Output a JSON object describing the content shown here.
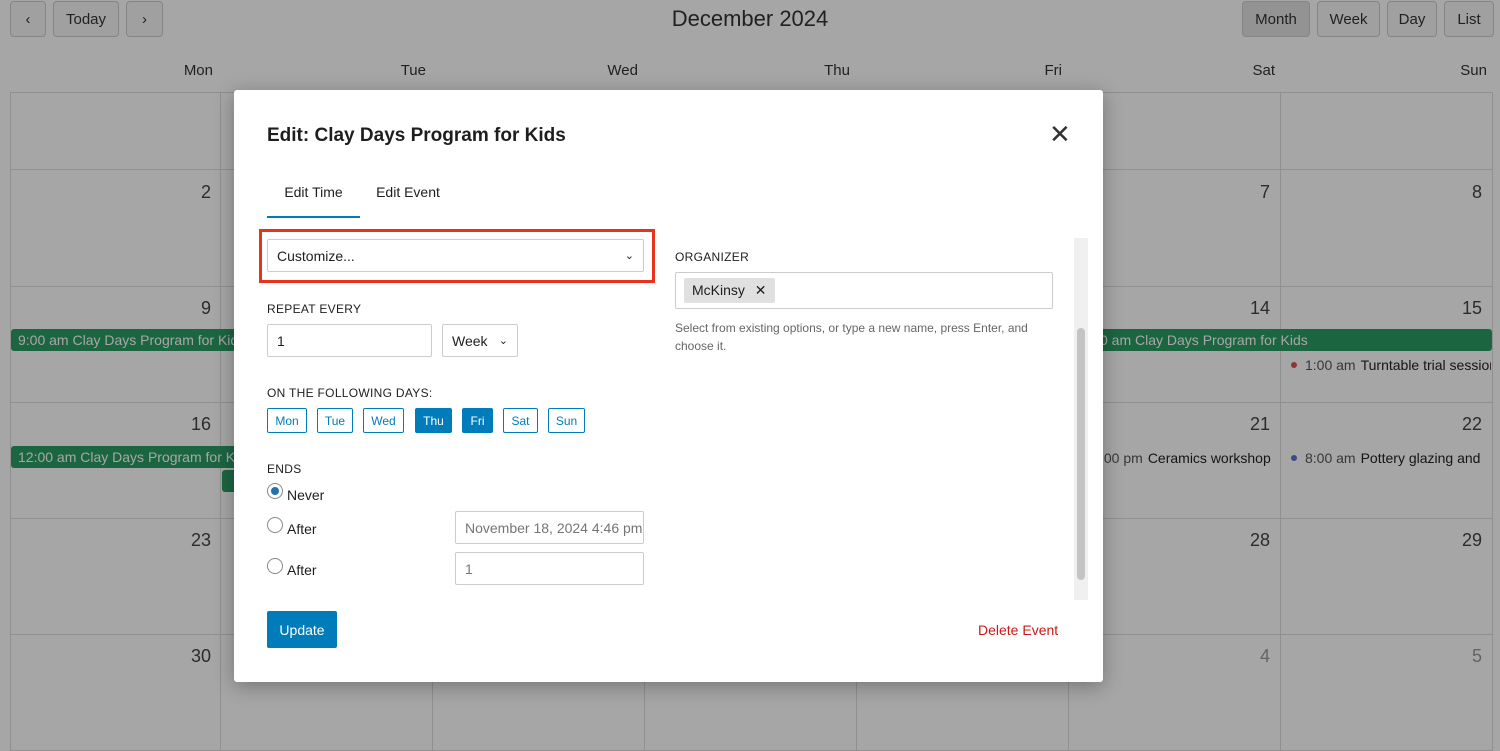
{
  "toolbar": {
    "prev_icon": "chevron-left-icon",
    "today": "Today",
    "next_icon": "chevron-right-icon",
    "title": "December 2024",
    "views": [
      "Month",
      "Week",
      "Day",
      "List"
    ],
    "active_view": "Month"
  },
  "weekdays": [
    "Mon",
    "Tue",
    "Wed",
    "Thu",
    "Fri",
    "Sat",
    "Sun"
  ],
  "dates": {
    "r2": {
      "mon": "2",
      "sat": "7",
      "sun": "8"
    },
    "r3": {
      "mon": "9",
      "sat": "14",
      "sun": "15"
    },
    "r4": {
      "mon": "16",
      "sat": "21",
      "sun": "22"
    },
    "r5": {
      "mon": "23",
      "sat": "28",
      "sun": "29"
    },
    "r6": {
      "mon": "30",
      "sat": "4",
      "sun": "5"
    }
  },
  "events": {
    "e1": {
      "time": "9:00 am",
      "title": "Clay Days Program for Kids"
    },
    "e2": {
      "time": "0 am",
      "title": "Clay Days Program for Kids"
    },
    "e3": {
      "time": "1:00 am",
      "title": "Turntable trial session",
      "color": "#d9534f"
    },
    "e4": {
      "time": "12:00 am",
      "title": "Clay Days Program for Kids"
    },
    "e5": {
      "time": ":00 pm",
      "title": "Ceramics workshop"
    },
    "e6": {
      "time": "8:00 am",
      "title": "Pottery glazing and",
      "color": "#5b6fd6"
    },
    "event_color": "#2a9d64"
  },
  "modal": {
    "title": "Edit: Clay Days Program for Kids",
    "close_icon": "close-icon",
    "tabs": [
      "Edit Time",
      "Edit Event"
    ],
    "active_tab": "Edit Time",
    "recurrence": "Customize...",
    "repeat_every_label": "REPEAT EVERY",
    "repeat_every_value": "1",
    "repeat_unit": "Week",
    "days_label": "ON THE FOLLOWING DAYS:",
    "days": [
      "Mon",
      "Tue",
      "Wed",
      "Thu",
      "Fri",
      "Sat",
      "Sun"
    ],
    "selected_days": [
      "Thu",
      "Fri"
    ],
    "ends_label": "ENDS",
    "ends_options": [
      "Never",
      "After",
      "After"
    ],
    "ends_selected": "Never",
    "end_date_placeholder": "November 18, 2024 4:46 pm",
    "end_count_placeholder": "1",
    "organizer_label": "ORGANIZER",
    "organizer_tag": "McKinsy",
    "organizer_help": "Select from existing options, or type a new name, press Enter, and choose it.",
    "update": "Update",
    "delete": "Delete Event",
    "accent": "#007cba",
    "highlight": "#e8321a"
  }
}
